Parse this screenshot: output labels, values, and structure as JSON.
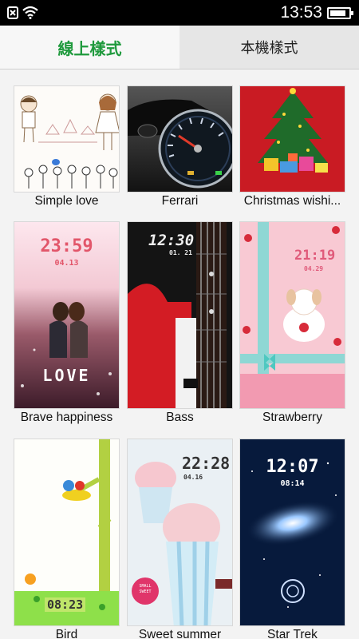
{
  "status_bar": {
    "time": "13:53",
    "battery_level": 0.85,
    "icons": [
      "close-x-icon",
      "wifi-icon",
      "battery-icon"
    ]
  },
  "tabs": [
    {
      "label": "線上樣式",
      "active": true
    },
    {
      "label": "本機樣式",
      "active": false
    }
  ],
  "themes": [
    {
      "name": "Simple love"
    },
    {
      "name": "Ferrari"
    },
    {
      "name": "Christmas wishi..."
    },
    {
      "name": "Brave happiness",
      "clock": "23:59",
      "date": "04.13",
      "word": "LOVE"
    },
    {
      "name": "Bass",
      "clock": "12:30",
      "date": "01. 21"
    },
    {
      "name": "Strawberry",
      "clock": "21:19",
      "date": "04.29"
    },
    {
      "name": "Bird",
      "clock": "08:23"
    },
    {
      "name": "Sweet summer",
      "clock": "22:28",
      "date": "04.16",
      "badge": "SMALL SWEET"
    },
    {
      "name": "Star Trek",
      "clock": "12:07",
      "date": "08:14"
    }
  ]
}
